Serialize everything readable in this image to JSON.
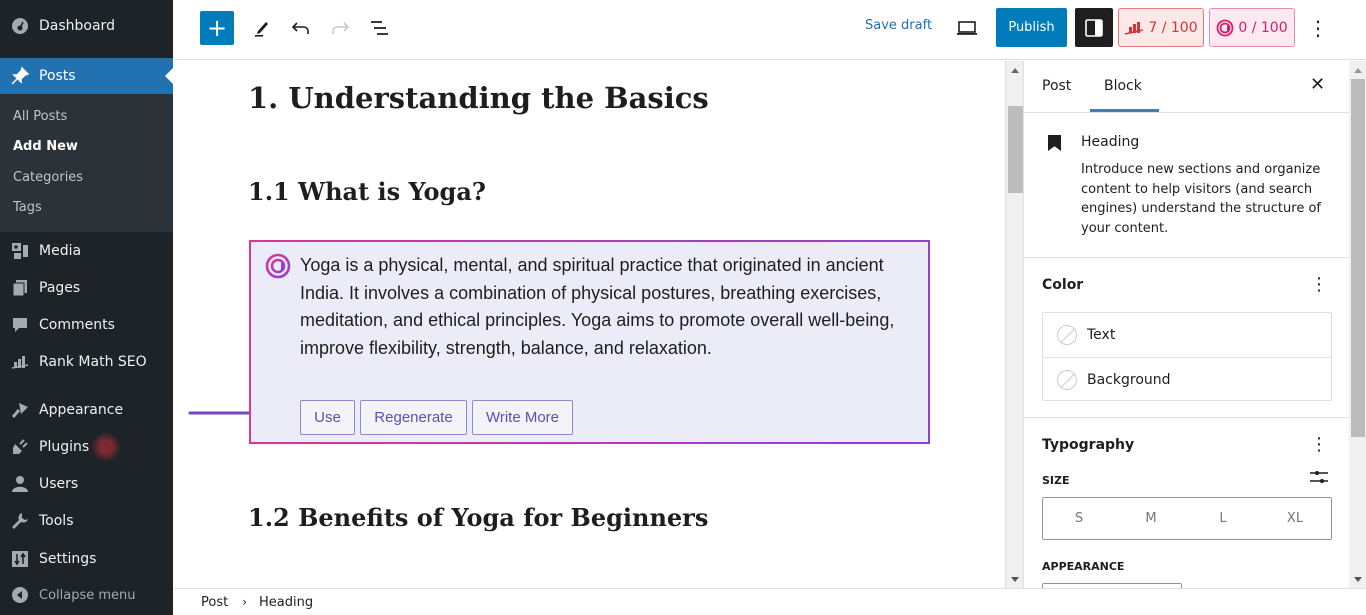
{
  "sidebar": {
    "dashboard": "Dashboard",
    "posts": "Posts",
    "posts_submenu": [
      "All Posts",
      "Add New",
      "Categories",
      "Tags"
    ],
    "media": "Media",
    "pages": "Pages",
    "comments": "Comments",
    "rank_math": "Rank Math SEO",
    "appearance": "Appearance",
    "plugins": "Plugins",
    "users": "Users",
    "tools": "Tools",
    "settings": "Settings",
    "collapse": "Collapse menu"
  },
  "toolbar": {
    "add_block_icon": "+",
    "save_draft": "Save draft",
    "publish": "Publish",
    "seo_score": "7 / 100",
    "ai_score": "0 / 100",
    "more_icon": "⋮"
  },
  "editor": {
    "heading1": "1. Understanding the Basics",
    "heading2": "1.1 What is Yoga?",
    "ai_suggestion": "Yoga is a physical, mental, and spiritual practice that originated in ancient India. It involves a combination of physical postures, breathing exercises, meditation, and ethical principles. Yoga aims to promote overall well-being, improve flexibility, strength, balance, and relaxation.",
    "ai_buttons": {
      "use": "Use",
      "regenerate": "Regenerate",
      "write_more": "Write More"
    },
    "heading3": "1.2 Benefits of Yoga for Beginners"
  },
  "panel": {
    "tabs": [
      "Post",
      "Block"
    ],
    "active_tab": "Block",
    "close_icon": "✕",
    "block_card": {
      "title": "Heading",
      "description": "Introduce new sections and organize content to help visitors (and search engines) understand the structure of your content."
    },
    "color": {
      "title": "Color",
      "items": [
        "Text",
        "Background"
      ]
    },
    "typography": {
      "title": "Typography",
      "size_label": "SIZE",
      "sizes": [
        "S",
        "M",
        "L",
        "XL"
      ],
      "appearance_label": "APPEARANCE"
    },
    "kebab_icon": "⋮"
  },
  "footer": {
    "breadcrumb": [
      "Post",
      "Heading"
    ],
    "separator": "›"
  },
  "colors": {
    "wp_blue": "#007cba",
    "admin_dark": "#1d2327",
    "rank_math_red": "#d83232",
    "ai_pink": "#d61f69",
    "ai_box_bg": "#ececf8",
    "ai_button_text": "#5b50b3",
    "arrow": "#7446c1"
  }
}
